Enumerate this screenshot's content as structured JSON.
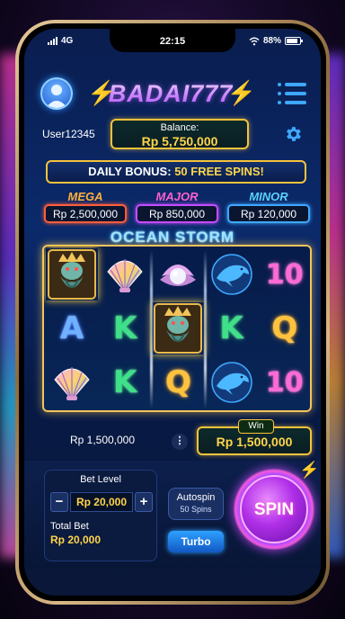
{
  "status_bar": {
    "network": "4G",
    "time": "22:15",
    "battery": "88%",
    "battery_level": 0.88
  },
  "header": {
    "logo": "BADAI777"
  },
  "user": {
    "name": "User12345"
  },
  "balance": {
    "label": "Balance:",
    "value": "Rp 5,750,000"
  },
  "bonus": {
    "prefix": "DAILY BONUS:",
    "highlight": "50 FREE SPINS!"
  },
  "jackpots": [
    {
      "name": "MEGA",
      "value": "Rp 2,500,000"
    },
    {
      "name": "MAJOR",
      "value": "Rp 850,000"
    },
    {
      "name": "MINOR",
      "value": "Rp 120,000"
    }
  ],
  "game": {
    "title": "OCEAN STORM"
  },
  "reels": {
    "rows": [
      [
        "poseidon",
        "shell",
        "pearl",
        "dolphin",
        "10"
      ],
      [
        "A",
        "K",
        "poseidon",
        "K",
        "Q"
      ],
      [
        "shell",
        "K",
        "Q",
        "dolphin",
        "10"
      ]
    ]
  },
  "results": {
    "paid": "Rp 1,500,000",
    "info_icon": "⋮",
    "win_label": "Win",
    "win_value": "Rp 1,500,000"
  },
  "bet": {
    "label": "Bet Level",
    "minus": "−",
    "value": "Rp 20,000",
    "plus": "+",
    "total_label": "Total Bet",
    "total_value": "Rp 20,000"
  },
  "autospin": {
    "label": "Autospin",
    "count": "50 Spins"
  },
  "turbo": {
    "label": "Turbo"
  },
  "spin": {
    "label": "SPIN"
  },
  "colors": {
    "accent_gold": "#ffd54a",
    "accent_purple": "#c44cff",
    "accent_blue": "#3ea8ff"
  }
}
